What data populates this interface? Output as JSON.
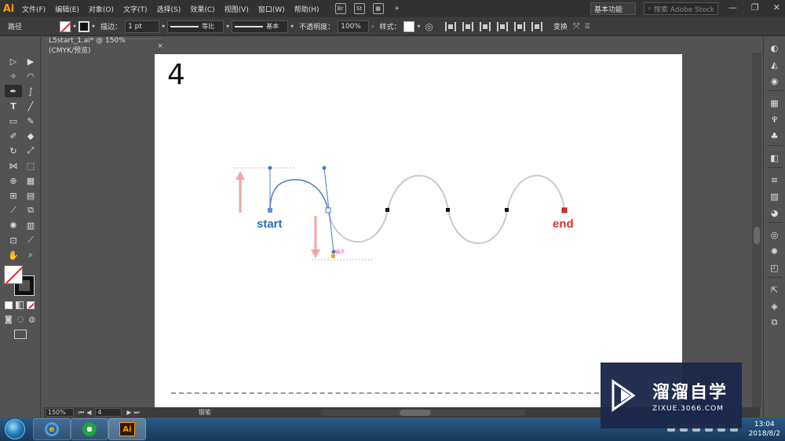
{
  "app": {
    "logo": "Ai"
  },
  "menu": [
    "文件(F)",
    "编辑(E)",
    "对象(O)",
    "文字(T)",
    "选择(S)",
    "效果(C)",
    "视图(V)",
    "窗口(W)",
    "帮助(H)"
  ],
  "menu_icons": [
    "Br",
    "St",
    "arrange-documents-icon",
    "gpu-performance-icon"
  ],
  "workspace": "基本功能",
  "stock_search_placeholder": "搜索 Adobe Stock",
  "control_bar": {
    "object_type": "路径",
    "stroke_label": "描边：",
    "stroke_weight": "1 pt",
    "profile": "等比",
    "brush": "基本",
    "opacity_label": "不透明度：",
    "opacity": "100%",
    "style_label": "样式：",
    "transform_label": "变换"
  },
  "document_tab": {
    "title": "L5start_1.ai* @ 150% (CMYK/预览)",
    "close": "×"
  },
  "artboard": {
    "step_number": "4",
    "start_label": "start",
    "end_label": "end",
    "anchor_hint": "锚点",
    "colors": {
      "start": "#2c6fb5",
      "end": "#d9322e",
      "path": "#c9c9cf",
      "handle": "#4a78c8",
      "guide": "#f2a5a5"
    }
  },
  "status_bar": {
    "zoom": "150%",
    "artboard_number": "4",
    "tool_name": "钢笔"
  },
  "taskbar": {
    "time": "13:04",
    "date": "2018/8/2"
  },
  "watermark": {
    "brand": "溜溜自学",
    "url": "ZIXUE.3066.COM"
  }
}
